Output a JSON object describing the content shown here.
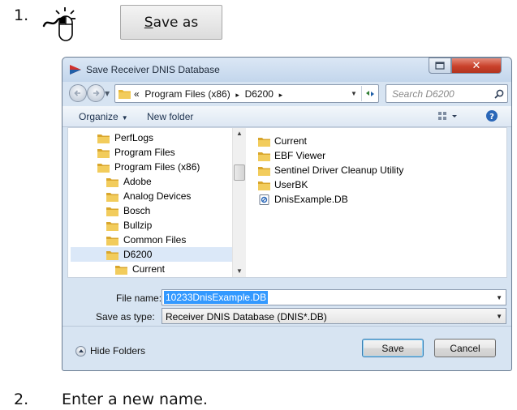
{
  "steps": [
    {
      "number": "1.",
      "text": ""
    },
    {
      "number": "2.",
      "text": "Enter a new name."
    }
  ],
  "save_as_button": {
    "prefix_underlined": "S",
    "label_rest": "ave as"
  },
  "dialog": {
    "title": "Save Receiver DNIS Database",
    "address": {
      "prefix": "«",
      "crumbs": [
        "Program Files (x86)",
        "D6200"
      ],
      "separator": "▸"
    },
    "search_placeholder": "Search D6200",
    "toolbar": {
      "organize": "Organize",
      "new_folder": "New folder"
    },
    "nav_tree": [
      {
        "label": "PerfLogs"
      },
      {
        "label": "Program Files"
      },
      {
        "label": "Program Files (x86)"
      },
      {
        "label": "Adobe"
      },
      {
        "label": "Analog Devices"
      },
      {
        "label": "Bosch"
      },
      {
        "label": "Bullzip"
      },
      {
        "label": "Common Files"
      },
      {
        "label": "D6200",
        "selected": true
      },
      {
        "label": "Current"
      }
    ],
    "files": [
      {
        "label": "Current",
        "type": "folder"
      },
      {
        "label": "EBF Viewer",
        "type": "folder"
      },
      {
        "label": "Sentinel Driver Cleanup Utility",
        "type": "folder"
      },
      {
        "label": "UserBK",
        "type": "folder"
      },
      {
        "label": "DnisExample.DB",
        "type": "db-file"
      }
    ],
    "file_name_label": "File name:",
    "file_name_value": "10233DnisExample.DB",
    "save_type_label": "Save as type:",
    "save_type_value": "Receiver DNIS Database (DNIS*.DB)",
    "hide_folders": "Hide Folders",
    "save_button": "Save",
    "cancel_button": "Cancel"
  },
  "colors": {
    "folder": "#e8b838",
    "selection": "#3399ff",
    "close_button": "#c9412b",
    "dialog_frame": "#d7e4f2"
  }
}
